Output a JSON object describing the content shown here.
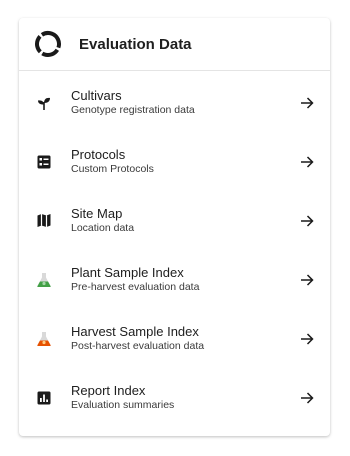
{
  "header": {
    "title": "Evaluation Data",
    "icon": "circle-progress-icon"
  },
  "colors": {
    "icon_dark": "#1a1a1a",
    "flask_green": "#43a047",
    "flask_orange": "#e65100"
  },
  "items": [
    {
      "title": "Cultivars",
      "subtitle": "Genotype registration data",
      "icon": "sprout-icon"
    },
    {
      "title": "Protocols",
      "subtitle": "Custom Protocols",
      "icon": "list-alt-icon"
    },
    {
      "title": "Site Map",
      "subtitle": "Location data",
      "icon": "map-icon"
    },
    {
      "title": "Plant Sample Index",
      "subtitle": "Pre-harvest evaluation data",
      "icon": "flask-green-icon"
    },
    {
      "title": "Harvest Sample Index",
      "subtitle": "Post-harvest evaluation data",
      "icon": "flask-orange-icon"
    },
    {
      "title": "Report Index",
      "subtitle": "Evaluation summaries",
      "icon": "bar-chart-icon"
    }
  ]
}
